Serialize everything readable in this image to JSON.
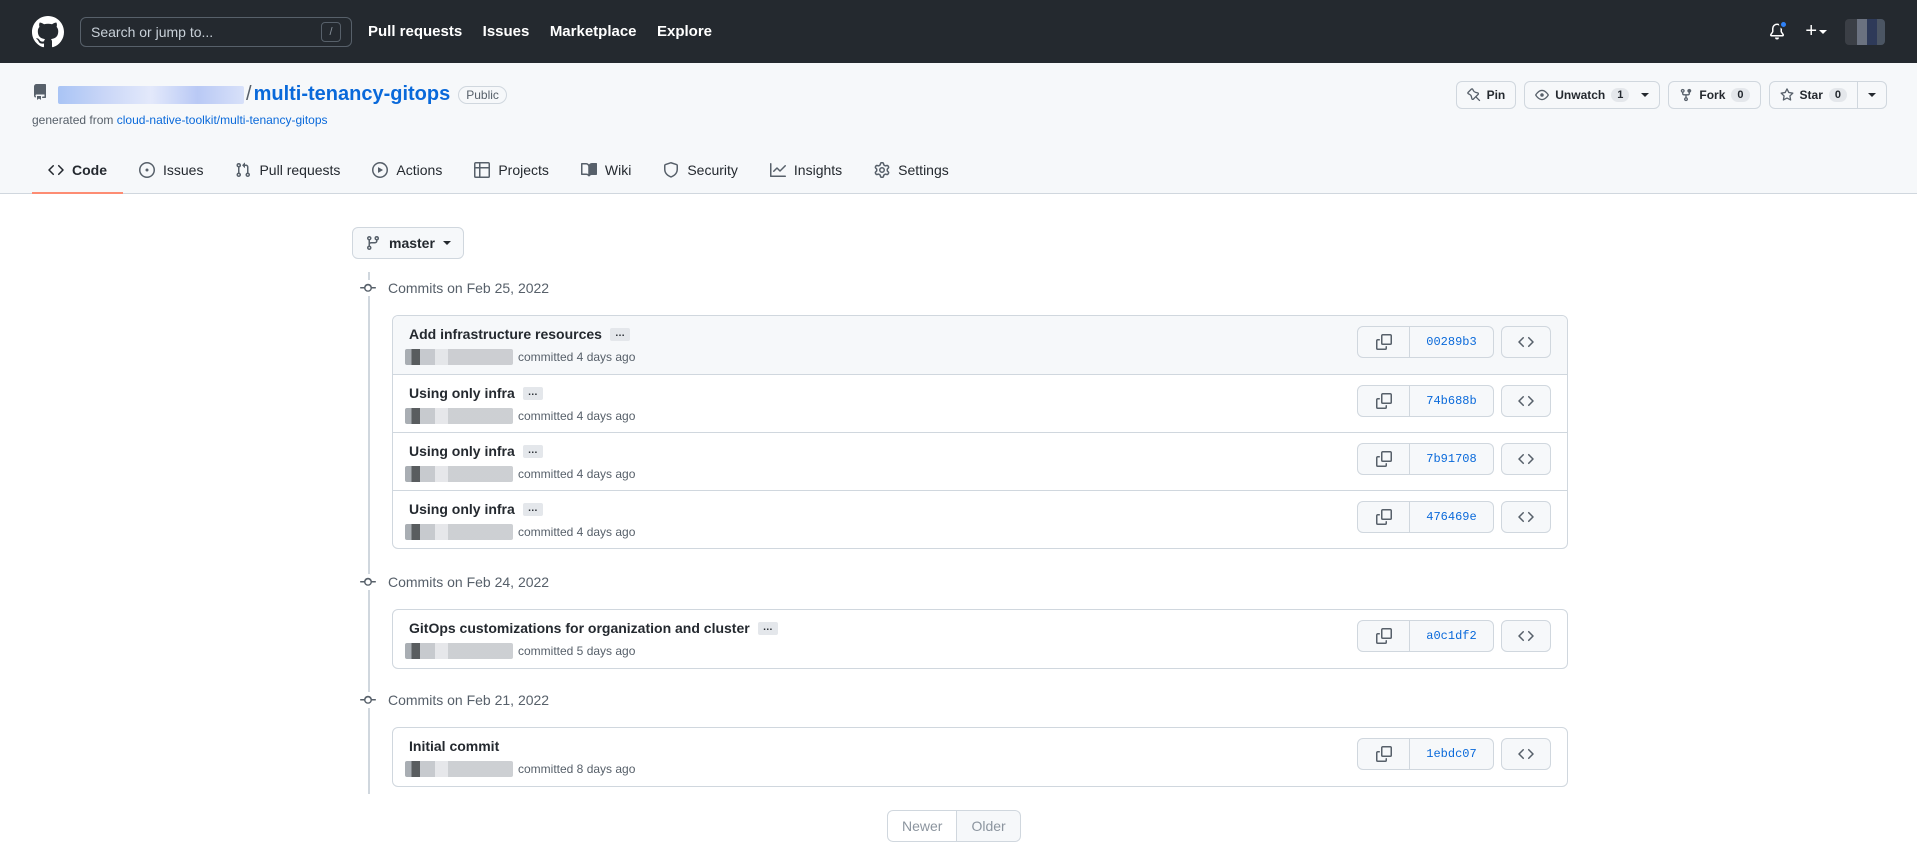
{
  "header": {
    "search_placeholder": "Search or jump to...",
    "search_key": "/",
    "nav": [
      "Pull requests",
      "Issues",
      "Marketplace",
      "Explore"
    ],
    "plus": "+"
  },
  "repo": {
    "separator": "/",
    "name": "multi-tenancy-gitops",
    "visibility": "Public",
    "generated_prefix": "generated from",
    "generated_link": "cloud-native-toolkit/multi-tenancy-gitops",
    "actions": {
      "pin": "Pin",
      "unwatch": "Unwatch",
      "watch_count": "1",
      "fork": "Fork",
      "fork_count": "0",
      "star": "Star",
      "star_count": "0"
    },
    "tabs": [
      {
        "label": "Code",
        "icon": "code-icon",
        "active": true
      },
      {
        "label": "Issues",
        "icon": "issue-icon"
      },
      {
        "label": "Pull requests",
        "icon": "pull-request-icon"
      },
      {
        "label": "Actions",
        "icon": "play-icon"
      },
      {
        "label": "Projects",
        "icon": "table-icon"
      },
      {
        "label": "Wiki",
        "icon": "book-icon"
      },
      {
        "label": "Security",
        "icon": "shield-icon"
      },
      {
        "label": "Insights",
        "icon": "graph-icon"
      },
      {
        "label": "Settings",
        "icon": "gear-icon"
      }
    ]
  },
  "branch": "master",
  "commit_groups": [
    {
      "heading": "Commits on Feb 25, 2022",
      "commits": [
        {
          "message": "Add infrastructure resources",
          "meta": "committed 4 days ago",
          "sha": "00289b3"
        },
        {
          "message": "Using only infra",
          "meta": "committed 4 days ago",
          "sha": "74b688b"
        },
        {
          "message": "Using only infra",
          "meta": "committed 4 days ago",
          "sha": "7b91708"
        },
        {
          "message": "Using only infra",
          "meta": "committed 4 days ago",
          "sha": "476469e"
        }
      ]
    },
    {
      "heading": "Commits on Feb 24, 2022",
      "commits": [
        {
          "message": "GitOps customizations for organization and cluster",
          "meta": "committed 5 days ago",
          "sha": "a0c1df2"
        }
      ]
    },
    {
      "heading": "Commits on Feb 21, 2022",
      "commits": [
        {
          "message": "Initial commit",
          "meta": "committed 8 days ago",
          "sha": "1ebdc07"
        }
      ]
    }
  ],
  "ellipsis": "…",
  "pagination": {
    "newer": "Newer",
    "older": "Older"
  }
}
